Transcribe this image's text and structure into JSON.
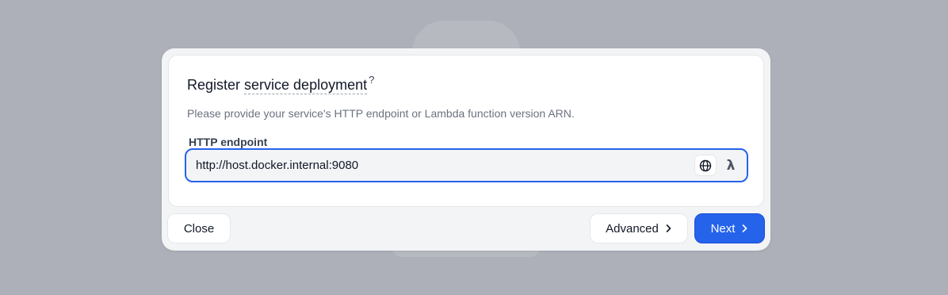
{
  "dialog": {
    "title_part1": "Register",
    "title_part2": "service deployment",
    "title_help": "?",
    "description": "Please provide your service's HTTP endpoint or Lambda function version ARN.",
    "field_label": "HTTP endpoint",
    "endpoint_value": "http://host.docker.internal:9080",
    "lambda_symbol": "λ"
  },
  "footer": {
    "close_label": "Close",
    "advanced_label": "Advanced",
    "next_label": "Next"
  },
  "icons": [
    "globe-icon",
    "lambda-icon",
    "chevron-right-icon"
  ],
  "colors": {
    "accent": "#2563eb",
    "backdrop": "#adb0b8"
  }
}
